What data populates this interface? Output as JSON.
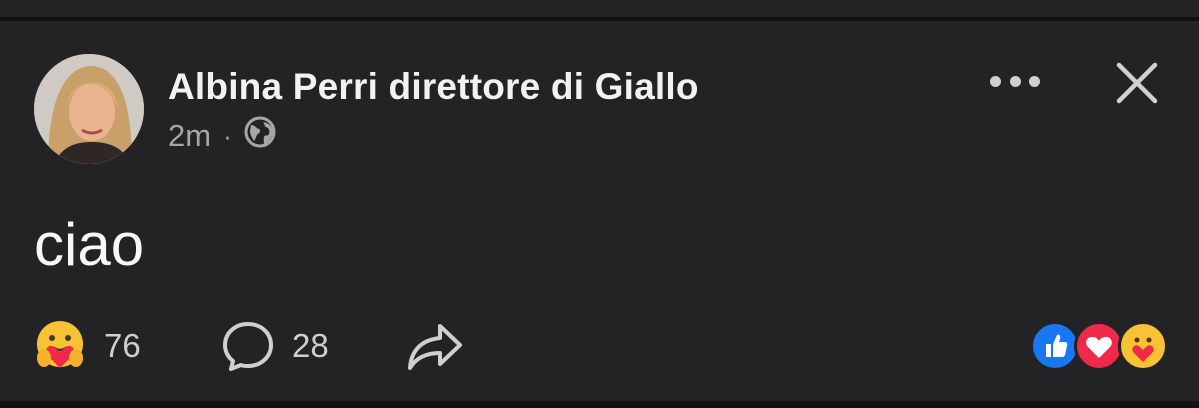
{
  "post": {
    "author_name": "Albina Perri direttore di Giallo",
    "timestamp": "2m",
    "separator": "·",
    "privacy_icon": "globe-icon",
    "text": "ciao"
  },
  "header": {
    "more_icon": "more-horizontal-icon",
    "close_icon": "close-icon"
  },
  "actions": {
    "reaction_icon": "care-emoji-icon",
    "reaction_count": "76",
    "comment_icon": "comment-bubble-icon",
    "comment_count": "28",
    "share_icon": "share-arrow-icon"
  },
  "reaction_summary": [
    "like-icon",
    "love-icon",
    "care-icon"
  ],
  "colors": {
    "background": "#232325",
    "text_primary": "#f2f2f2",
    "text_secondary": "#a6a6a8",
    "like_blue": "#1877f2",
    "love_red": "#f0284a",
    "care_yellow": "#f7c233"
  }
}
